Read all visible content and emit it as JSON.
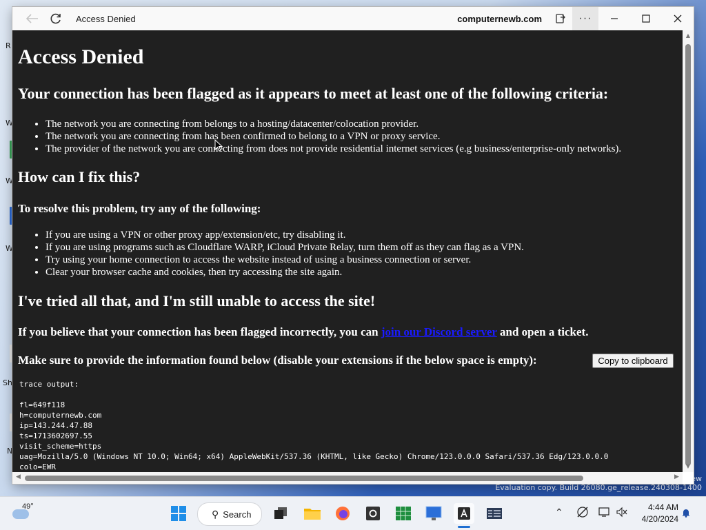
{
  "browser": {
    "title": "Access Denied",
    "domain": "computernewb.com",
    "more_label": "···"
  },
  "page": {
    "heading": "Access Denied",
    "subheading": "Your connection has been flagged as it appears to meet at least one of the following criteria:",
    "criteria": [
      "The network you are connecting from belongs to a hosting/datacenter/colocation provider.",
      "The network you are connecting from has been confirmed to belong to a VPN or proxy service.",
      "The provider of the network you are connecting from does not provide residential internet services (e.g business/enterprise-only networks)."
    ],
    "fix_heading": "How can I fix this?",
    "resolve_heading": "To resolve this problem, try any of the following:",
    "fixes": [
      "If you are using a VPN or other proxy app/extension/etc, try disabling it.",
      "If you are using programs such as Cloudflare WARP, iCloud Private Relay, turn them off as they can flag as a VPN.",
      "Try using your home connection to access the website instead of using a business connection or server.",
      "Clear your browser cache and cookies, then try accessing the site again."
    ],
    "tried_heading": "I've tried all that, and I'm still unable to access the site!",
    "ticket_prefix": "If you believe that your connection has been flagged incorrectly, you can ",
    "ticket_link": "join our Discord server",
    "ticket_suffix": " and open a ticket.",
    "info_text": "Make sure to provide the information found below (disable your extensions if the below space is empty):",
    "copy_button": "Copy to clipboard",
    "trace_label": "trace output:",
    "trace_lines": [
      "fl=649f118",
      "h=computernewb.com",
      "ip=143.244.47.88",
      "ts=1713602697.55",
      "visit_scheme=https",
      "uag=Mozilla/5.0 (Windows NT 10.0; Win64; x64) AppleWebKit/537.36 (KHTML, like Gecko) Chrome/123.0.0.0 Safari/537.36 Edg/123.0.0.0",
      "colo=EWR"
    ]
  },
  "desktop": {
    "watermark_1": "ew",
    "watermark_2": "Evaluation copy. Build 26080.ge_release.240308-1400",
    "edge_letters": [
      "R",
      "W",
      "W",
      "W",
      "Sh",
      "N"
    ]
  },
  "taskbar": {
    "weather_temp": "49°",
    "search_label": "Search",
    "time": "4:44 AM",
    "date": "4/20/2024",
    "icons": [
      "start-icon",
      "search-icon",
      "task-view-icon",
      "file-explorer-icon",
      "firefox-icon",
      "app-o-icon",
      "excel-grid-icon",
      "remote-desktop-icon",
      "font-app-icon",
      "calculator-icon"
    ]
  }
}
